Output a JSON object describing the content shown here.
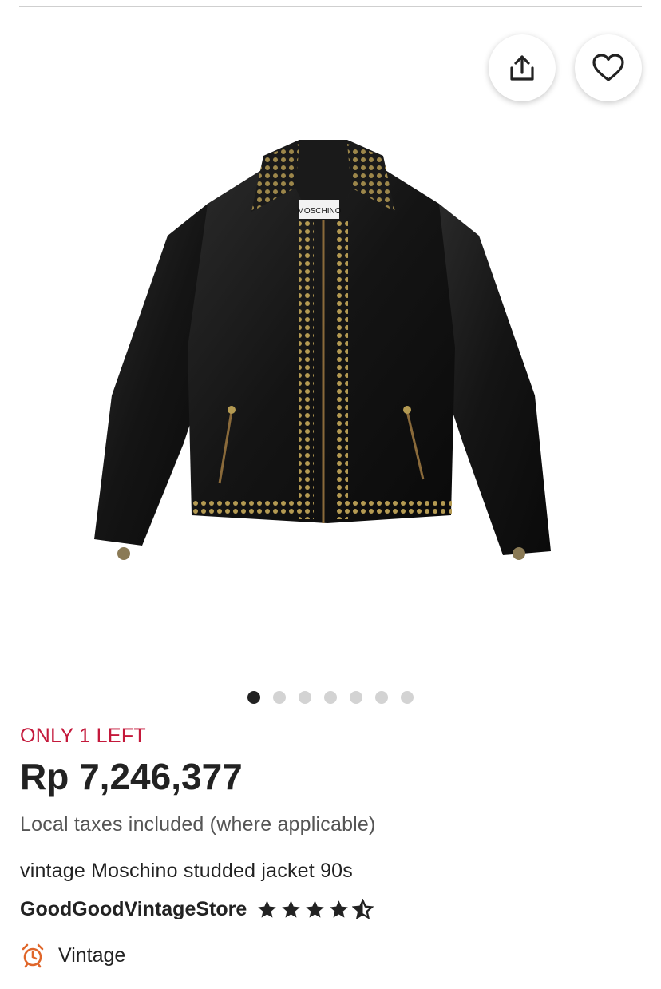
{
  "listing": {
    "stock_label": "ONLY 1 LEFT",
    "price": "Rp 7,246,377",
    "tax_note": "Local taxes included (where applicable)",
    "title": "vintage Moschino studded jacket 90s"
  },
  "jacket_label_text": "MOSCHINO",
  "shop": {
    "name": "GoodGoodVintageStore",
    "rating": 4.5,
    "max_rating": 5
  },
  "tag": {
    "label": "Vintage",
    "icon": "alarm-clock-icon"
  },
  "carousel": {
    "total": 7,
    "active_index": 0
  },
  "colors": {
    "accent_red": "#c4193b",
    "stock_orange": "#e0662a",
    "text": "#222222"
  }
}
